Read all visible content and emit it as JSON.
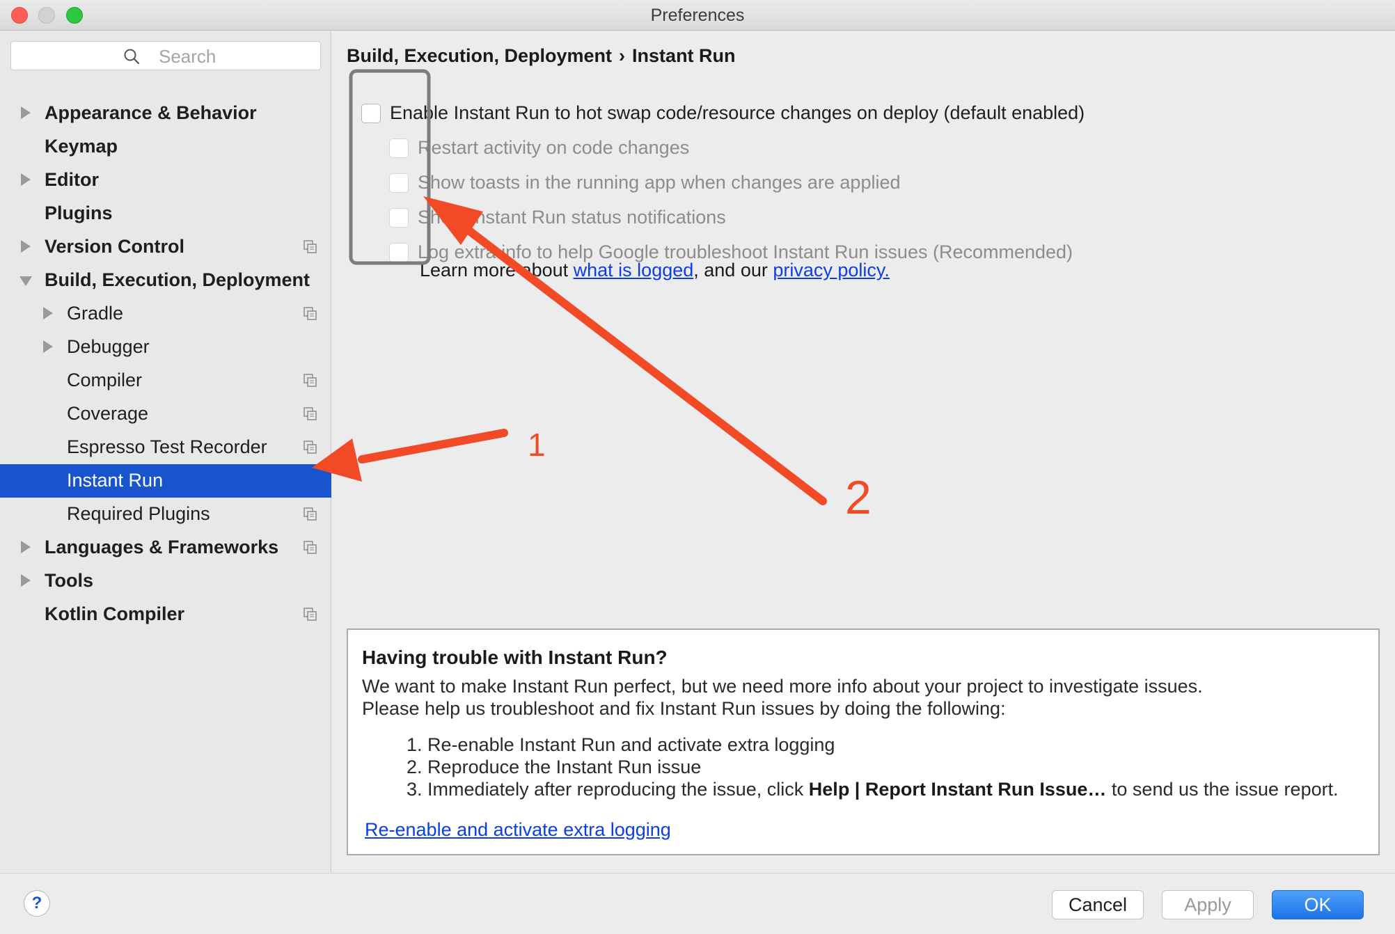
{
  "window": {
    "title": "Preferences"
  },
  "sidebar": {
    "search_placeholder": "Search",
    "items": [
      {
        "label": "Appearance & Behavior"
      },
      {
        "label": "Keymap"
      },
      {
        "label": "Editor"
      },
      {
        "label": "Plugins"
      },
      {
        "label": "Version Control"
      },
      {
        "label": "Build, Execution, Deployment"
      },
      {
        "label": "Gradle"
      },
      {
        "label": "Debugger"
      },
      {
        "label": "Compiler"
      },
      {
        "label": "Coverage"
      },
      {
        "label": "Espresso Test Recorder"
      },
      {
        "label": "Instant Run",
        "selected": true
      },
      {
        "label": "Required Plugins"
      },
      {
        "label": "Languages & Frameworks"
      },
      {
        "label": "Tools"
      },
      {
        "label": "Kotlin Compiler"
      }
    ]
  },
  "main": {
    "breadcrumb": {
      "parent": "Build, Execution, Deployment",
      "separator": "›",
      "current": "Instant Run"
    },
    "options": [
      {
        "label": "Enable Instant Run to hot swap code/resource changes on deploy (default enabled)",
        "checked": false
      },
      {
        "label": "Restart activity on code changes",
        "checked": false,
        "disabled": true
      },
      {
        "label": "Show toasts in the running app when changes are applied",
        "checked": false,
        "disabled": true
      },
      {
        "label": "Show Instant Run status notifications",
        "checked": false,
        "disabled": true
      },
      {
        "label": "Log extra info to help Google troubleshoot Instant Run issues (Recommended)",
        "checked": false,
        "disabled": true
      }
    ],
    "learn_more": {
      "prefix": "Learn more about ",
      "link1": "what is logged",
      "middle": ", and our ",
      "link2": "privacy policy."
    },
    "panel": {
      "title": "Having trouble with Instant Run?",
      "line1": "We want to make Instant Run perfect, but we need more info about your project to investigate issues.",
      "line2": "Please help us troubleshoot and fix Instant Run issues by doing the following:",
      "steps": [
        {
          "num": "1.",
          "text": "Re-enable Instant Run and activate extra logging"
        },
        {
          "num": "2.",
          "text": "Reproduce the Instant Run issue"
        },
        {
          "num": "3.",
          "pre": "Immediately after reproducing the issue, click ",
          "bold": "Help | Report Instant Run Issue…",
          "post": " to send us the issue report."
        }
      ],
      "link": "Re-enable and activate extra logging"
    }
  },
  "footer": {
    "help": "?",
    "cancel": "Cancel",
    "apply": "Apply",
    "ok": "OK"
  },
  "annotations": {
    "label1": "1",
    "label2": "2",
    "color": "#f04a26"
  }
}
